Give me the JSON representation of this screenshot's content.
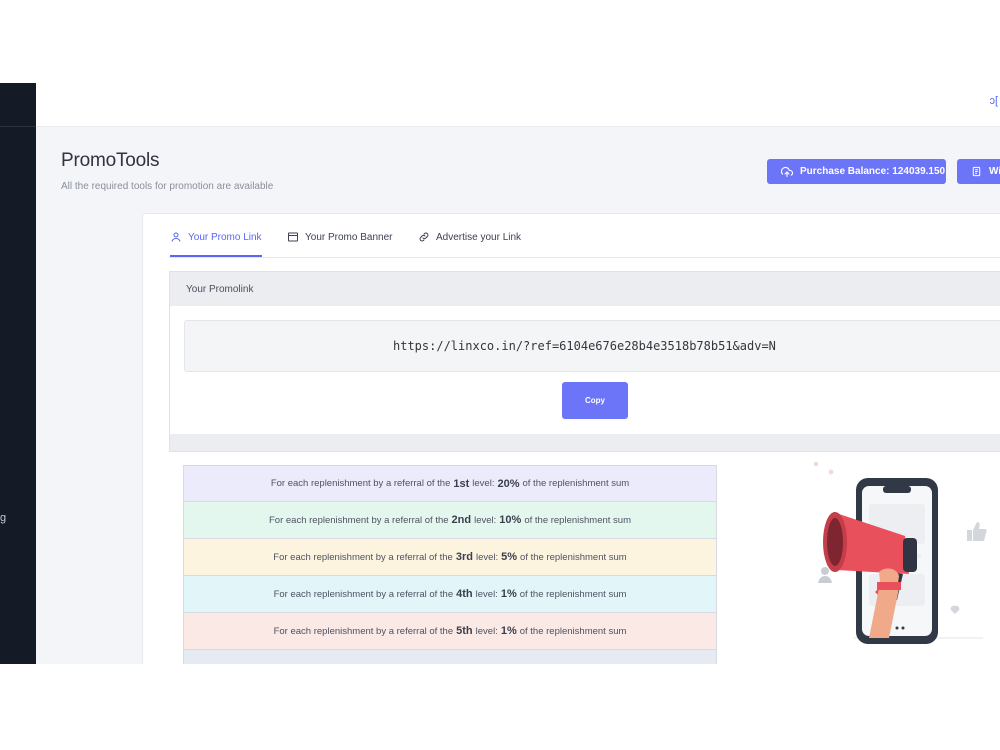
{
  "sidebar": {
    "fragment": "g"
  },
  "topbar": {
    "icon": "refresh-icon",
    "fragment": "ↄ["
  },
  "page": {
    "title": "PromoTools",
    "subtitle": "All the required tools for promotion are available"
  },
  "actions": {
    "purchase_balance": "Purchase Balance: 124039.150",
    "withdraw_fragment": "Wi"
  },
  "tabs": [
    {
      "label": "Your Promo Link",
      "icon": "user-icon",
      "active": true
    },
    {
      "label": "Your Promo Banner",
      "icon": "window-icon",
      "active": false
    },
    {
      "label": "Advertise your Link",
      "icon": "link-icon",
      "active": false
    }
  ],
  "promolink": {
    "header": "Your Promolink",
    "url": "https://linxco.in/?ref=6104e676e28b4e3518b78b51&adv=N",
    "copy_label": "Copy"
  },
  "levels": [
    {
      "pre": "For each replenishment by a referral of the",
      "level": "1st",
      "mid": "level:",
      "pct": "20%",
      "post": "of the replenishment sum",
      "color": "#ecebfc"
    },
    {
      "pre": "For each replenishment by a referral of the",
      "level": "2nd",
      "mid": "level:",
      "pct": "10%",
      "post": "of the replenishment sum",
      "color": "#e3f7ee"
    },
    {
      "pre": "For each replenishment by a referral of the",
      "level": "3rd",
      "mid": "level:",
      "pct": "5%",
      "post": "of the replenishment sum",
      "color": "#fdf4e0"
    },
    {
      "pre": "For each replenishment by a referral of the",
      "level": "4th",
      "mid": "level:",
      "pct": "1%",
      "post": "of the replenishment sum",
      "color": "#e2f6fa"
    },
    {
      "pre": "For each replenishment by a referral of the",
      "level": "5th",
      "mid": "level:",
      "pct": "1%",
      "post": "of the replenishment sum",
      "color": "#fbe9e6"
    },
    {
      "pre": "",
      "level": "",
      "mid": "",
      "pct": "",
      "post": "",
      "color": "#e6eaf3"
    }
  ],
  "colors": {
    "accent": "#6c74f8",
    "sidebar": "#141b27",
    "megaphone": "#e8505b"
  }
}
